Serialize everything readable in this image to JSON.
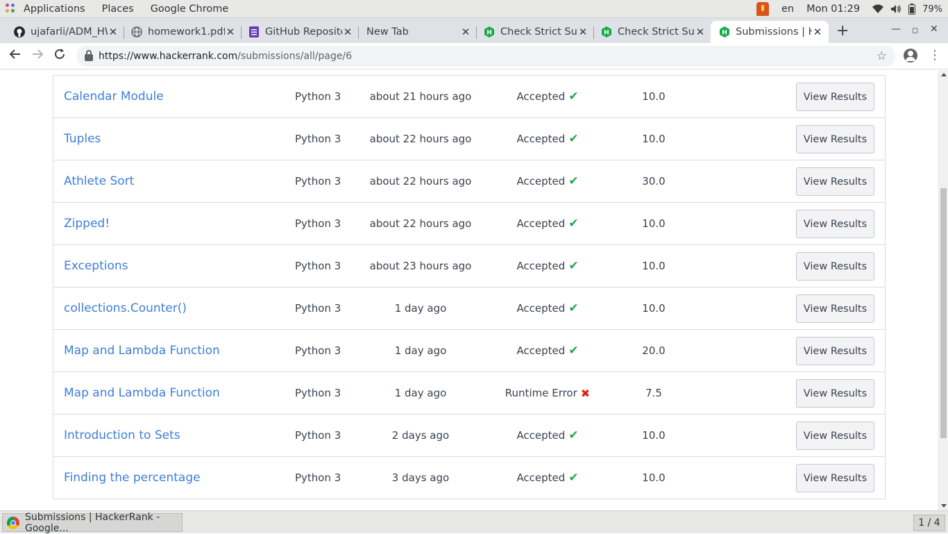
{
  "topbar": {
    "applications_label": "Applications",
    "places_label": "Places",
    "active_app_label": "Google Chrome",
    "language": "en",
    "clock": "Mon 01:29",
    "battery": "79%"
  },
  "tabs": [
    {
      "title": "ujafarli/ADM_HW",
      "icon": "github-icon"
    },
    {
      "title": "homework1.pdf",
      "icon": "globe-icon"
    },
    {
      "title": "GitHub Repository",
      "icon": "form-icon"
    },
    {
      "title": "New Tab",
      "icon": ""
    },
    {
      "title": "Check Strict Superset",
      "icon": "hackerrank-icon"
    },
    {
      "title": "Check Strict Superset",
      "icon": "hackerrank-icon"
    },
    {
      "title": "Submissions | HackerRank",
      "icon": "hackerrank-icon"
    }
  ],
  "address": {
    "host": "https://www.hackerrank.com",
    "path": "/submissions/all/page/6"
  },
  "submissions": [
    {
      "name": "Calendar Module",
      "language": "Python 3",
      "time": "about 21 hours ago",
      "status": "Accepted",
      "ok": true,
      "score": "10.0",
      "action": "View Results"
    },
    {
      "name": "Tuples",
      "language": "Python 3",
      "time": "about 22 hours ago",
      "status": "Accepted",
      "ok": true,
      "score": "10.0",
      "action": "View Results"
    },
    {
      "name": "Athlete Sort",
      "language": "Python 3",
      "time": "about 22 hours ago",
      "status": "Accepted",
      "ok": true,
      "score": "30.0",
      "action": "View Results"
    },
    {
      "name": "Zipped!",
      "language": "Python 3",
      "time": "about 22 hours ago",
      "status": "Accepted",
      "ok": true,
      "score": "10.0",
      "action": "View Results"
    },
    {
      "name": "Exceptions",
      "language": "Python 3",
      "time": "about 23 hours ago",
      "status": "Accepted",
      "ok": true,
      "score": "10.0",
      "action": "View Results"
    },
    {
      "name": "collections.Counter()",
      "language": "Python 3",
      "time": "1 day ago",
      "status": "Accepted",
      "ok": true,
      "score": "10.0",
      "action": "View Results"
    },
    {
      "name": "Map and Lambda Function",
      "language": "Python 3",
      "time": "1 day ago",
      "status": "Accepted",
      "ok": true,
      "score": "20.0",
      "action": "View Results"
    },
    {
      "name": "Map and Lambda Function",
      "language": "Python 3",
      "time": "1 day ago",
      "status": "Runtime Error",
      "ok": false,
      "score": "7.5",
      "action": "View Results"
    },
    {
      "name": "Introduction to Sets",
      "language": "Python 3",
      "time": "2 days ago",
      "status": "Accepted",
      "ok": true,
      "score": "10.0",
      "action": "View Results"
    },
    {
      "name": "Finding the percentage",
      "language": "Python 3",
      "time": "3 days ago",
      "status": "Accepted",
      "ok": true,
      "score": "10.0",
      "action": "View Results"
    }
  ],
  "taskbar": {
    "window_label": "Submissions | HackerRank - Google...",
    "workspace": "1 / 4"
  },
  "colors": {
    "link": "#3d7ed8",
    "accepted": "#1ba94c",
    "error": "#e0221c",
    "hackerrank": "#1ba94c"
  }
}
